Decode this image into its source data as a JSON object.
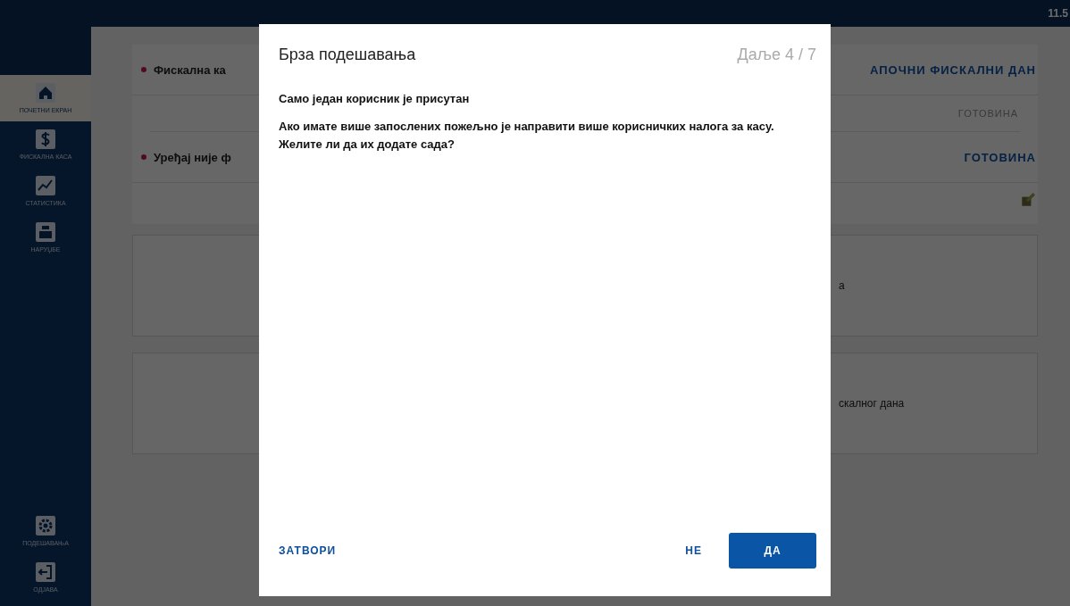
{
  "top_bar": {
    "time": "11.5"
  },
  "sidebar": {
    "items": [
      {
        "kind": "home",
        "label": "ПОЧЕТНИ ЕКРАН",
        "selected": true
      },
      {
        "kind": "dollar",
        "label": "ФИСКАЛНА КАСА",
        "selected": false
      },
      {
        "kind": "chart",
        "label": "СТАТИСТИКА",
        "selected": false
      },
      {
        "kind": "register",
        "label": "НАРУЏБЕ",
        "selected": false
      }
    ],
    "bottom_items": [
      {
        "kind": "gear",
        "label": "ПОДЕШАВАЊА",
        "selected": false
      },
      {
        "kind": "logout",
        "label": "ОДЈАВА",
        "selected": false
      }
    ]
  },
  "status_rows": [
    {
      "kind": "alert",
      "title": "Фискална ка",
      "action": "АПОЧНИ ФИСКАЛНИ ДАН"
    },
    {
      "kind": "plain",
      "action": "ГОТОВИНА"
    },
    {
      "kind": "alert",
      "title": "Уређај није ф",
      "action": "ГОТОВИНА"
    }
  ],
  "cards": [
    {
      "text": "а"
    },
    {
      "text": "скалног дана"
    }
  ],
  "dialog": {
    "title": "Брза подешавања",
    "step": "Даље 4 / 7",
    "heading": "Само један корисник је присутан",
    "message": "Ако имате више запослених пожељно је направити више корисничких налога за касу. Желите ли да их додате сада?",
    "buttons": [
      {
        "label": "ЗАТВОРИ",
        "kind": "text"
      },
      {
        "label": "НЕ",
        "kind": "text"
      },
      {
        "label": "ДА",
        "kind": "primary"
      }
    ]
  }
}
